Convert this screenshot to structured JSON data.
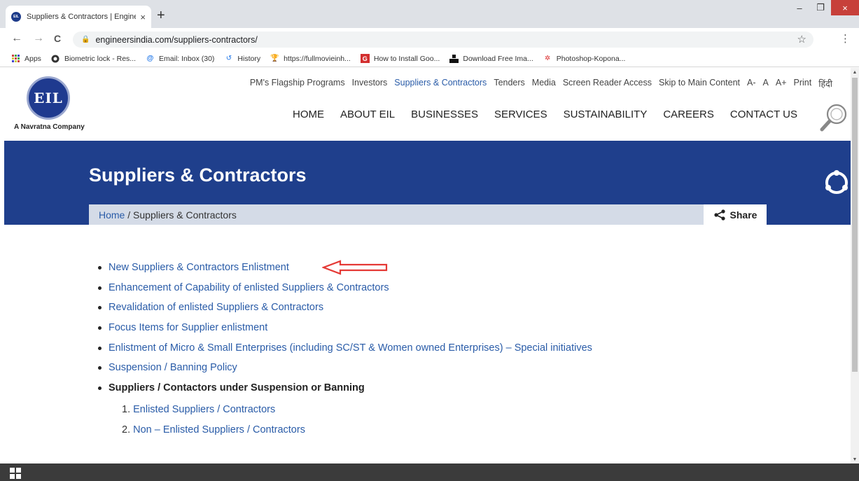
{
  "browser": {
    "tab_title": "Suppliers & Contractors | Engine",
    "tab_close": "×",
    "new_tab": "+",
    "url": "engineersindia.com/suppliers-contractors/",
    "window_controls": {
      "minimize": "–",
      "restore": "❐",
      "close": "×"
    },
    "nav": {
      "back": "←",
      "forward": "→",
      "reload": "C"
    },
    "bookmarks": [
      {
        "label": "Apps",
        "icon": "apps-grid-icon"
      },
      {
        "label": "Biometric lock - Res...",
        "icon": "globe-icon"
      },
      {
        "label": "Email: Inbox (30)",
        "icon": "email-icon"
      },
      {
        "label": "History",
        "icon": "history-icon"
      },
      {
        "label": "https://fullmovieinh...",
        "icon": "movie-icon"
      },
      {
        "label": "How to Install Goo...",
        "icon": "g-icon"
      },
      {
        "label": "Download Free Ima...",
        "icon": "download-icon"
      },
      {
        "label": "Photoshop-Kopona...",
        "icon": "photoshop-icon"
      }
    ]
  },
  "site": {
    "logo_text": "EIL",
    "tagline": "A Navratna Company",
    "top_nav": [
      "PM's Flagship Programs",
      "Investors",
      "Suppliers & Contractors",
      "Tenders",
      "Media",
      "Screen Reader Access",
      "Skip to Main Content",
      "A-",
      "A",
      "A+",
      "Print",
      "हिंदी"
    ],
    "main_nav": [
      "HOME",
      "ABOUT EIL",
      "BUSINESSES",
      "SERVICES",
      "SUSTAINABILITY",
      "CAREERS",
      "CONTACT US"
    ],
    "banner_title": "Suppliers & Contractors",
    "breadcrumb": {
      "home": "Home",
      "separator": " / ",
      "current": "Suppliers & Contractors"
    },
    "share_label": "Share",
    "links": [
      "New Suppliers & Contractors Enlistment",
      "Enhancement of Capability of enlisted Suppliers & Contractors",
      "Revalidation of enlisted Suppliers & Contractors",
      "Focus Items for Supplier enlistment",
      "Enlistment of Micro & Small Enterprises (including SC/ST & Women owned Enterprises) – Special initiatives",
      "Suspension / Banning Policy"
    ],
    "bold_item": "Suppliers / Contactors under Suspension or Banning",
    "sub_items": [
      {
        "num": "1.",
        "label": "Enlisted Suppliers / Contractors"
      },
      {
        "num": "2.",
        "label": "Non – Enlisted Suppliers / Contractors"
      }
    ]
  },
  "colors": {
    "banner": "#1f3f8c",
    "link": "#2a5ca8",
    "annotation_arrow": "#e53935"
  }
}
